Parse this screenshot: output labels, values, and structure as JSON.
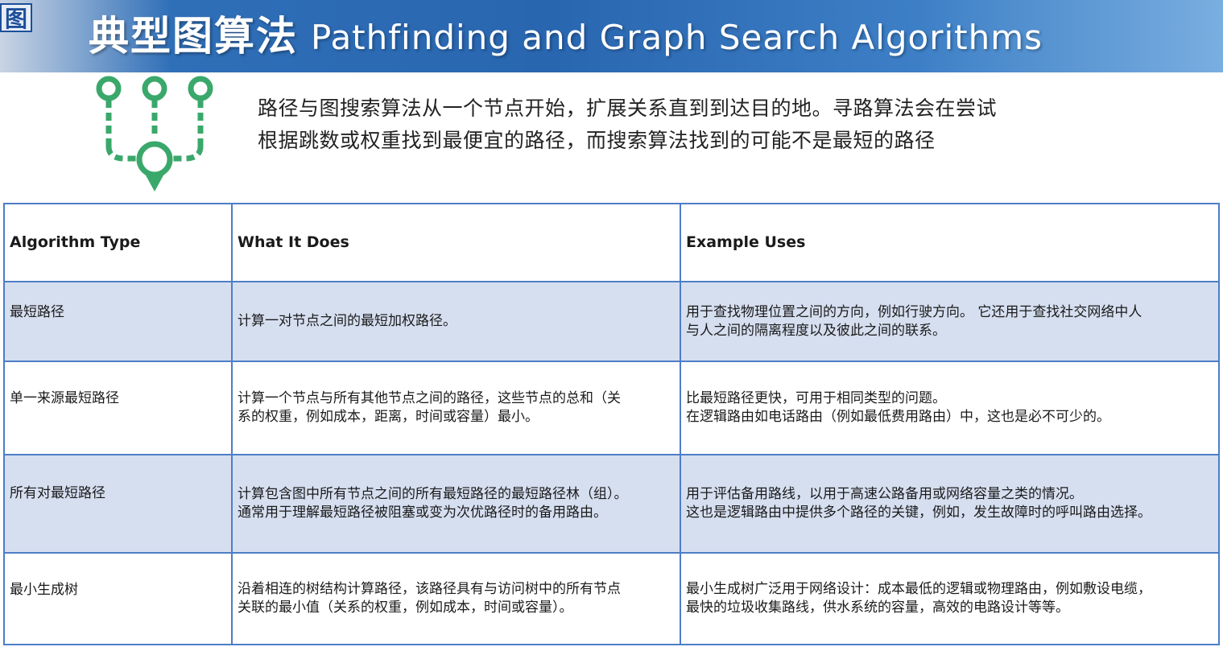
{
  "header": {
    "corner_mark": "图",
    "title_cn": "典型图算法",
    "title_en": "Pathfinding and Graph Search Algorithms"
  },
  "intro": {
    "line1": "路径与图搜索算法从一个节点开始，扩展关系直到到达目的地。寻路算法会在尝试",
    "line2": "根据跳数或权重找到最便宜的路径，而搜索算法找到的可能不是最短的路径"
  },
  "icon": {
    "name": "graph-merge-icon",
    "color": "#3aa86b"
  },
  "table": {
    "headers": [
      "Algorithm Type",
      "What It Does",
      "Example Uses"
    ],
    "rows": [
      {
        "type": "最短路径",
        "does": [
          "计算一对节点之间的最短加权路径。"
        ],
        "uses": [
          "用于查找物理位置之间的方向，例如行驶方向。 它还用于查找社交网络中人",
          "与人之间的隔离程度以及彼此之间的联系。"
        ]
      },
      {
        "type": "单一来源最短路径",
        "does": [
          "计算一个节点与所有其他节点之间的路径，这些节点的总和（关",
          "系的权重，例如成本，距离，时间或容量）最小。"
        ],
        "uses": [
          "比最短路径更快，可用于相同类型的问题。",
          "在逻辑路由如电话路由（例如最低费用路由）中，这也是必不可少的。"
        ]
      },
      {
        "type": "所有对最短路径",
        "does": [
          "计算包含图中所有节点之间的所有最短路径的最短路径林（组）。",
          "通常用于理解最短路径被阻塞或变为次优路径时的备用路由。"
        ],
        "uses": [
          "用于评估备用路线，以用于高速公路备用或网络容量之类的情况。",
          "这也是逻辑路由中提供多个路径的关键，例如，发生故障时的呼叫路由选择。"
        ]
      },
      {
        "type": "最小生成树",
        "does": [
          "沿着相连的树结构计算路径，该路径具有与访问树中的所有节点",
          "关联的最小值（关系的权重，例如成本，时间或容量）。"
        ],
        "uses": [
          "最小生成树广泛用于网络设计：成本最低的逻辑或物理路由，例如敷设电缆，",
          "最快的垃圾收集路线，供水系统的容量，高效的电路设计等等。"
        ]
      }
    ]
  },
  "colors": {
    "header_blue": "#2966b0",
    "table_border": "#4c7ec6",
    "row_highlight": "#d6dff0",
    "icon_green": "#3aa86b"
  }
}
